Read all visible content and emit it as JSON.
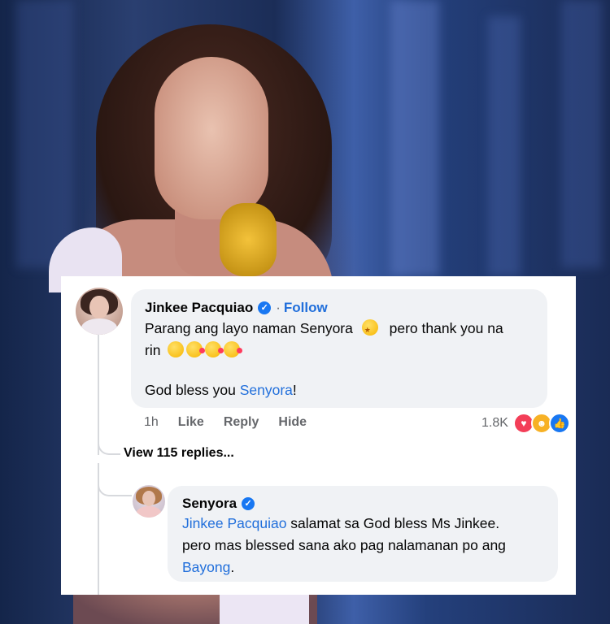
{
  "comment1": {
    "author": "Jinkee Pacquiao",
    "follow_sep": "·",
    "follow_label": "Follow",
    "line1": "Parang ang layo naman Senyora",
    "line1_tail": "pero thank you na",
    "line2": "rin",
    "line3_prefix": "God bless you ",
    "line3_mention": "Senyora",
    "line3_suffix": "!",
    "time": "1h",
    "like_label": "Like",
    "reply_label": "Reply",
    "hide_label": "Hide",
    "reaction_count": "1.8K",
    "reactions": [
      "love-icon",
      "haha-icon",
      "like-icon"
    ]
  },
  "view_replies": "View 115 replies...",
  "comment2": {
    "author": "Senyora",
    "mention": "Jinkee Pacquiao",
    "line1_tail": " salamat sa God bless Ms Jinkee.",
    "line2": "pero mas blessed sana ako pag nalamanan po ang",
    "line3_mention": "Bayong",
    "line3_suffix": "."
  },
  "colors": {
    "bubble": "#f0f2f5",
    "link": "#216fdb",
    "verified": "#1877f2",
    "meta": "#65676b"
  }
}
